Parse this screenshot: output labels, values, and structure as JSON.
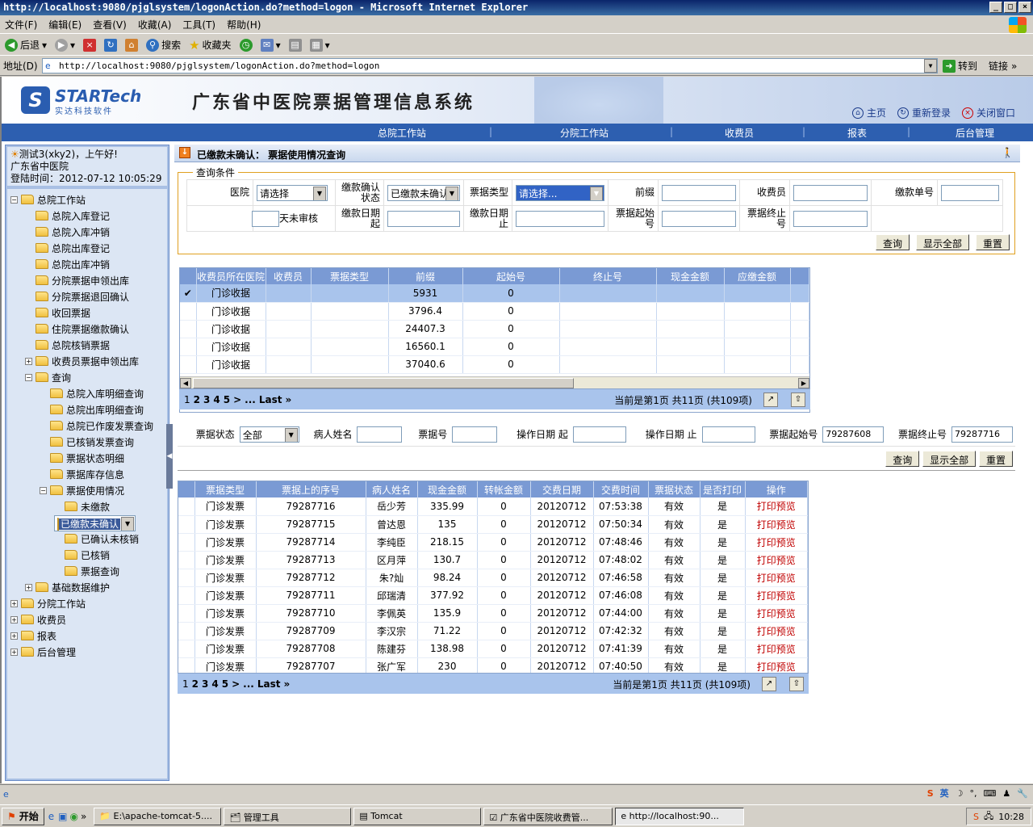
{
  "window": {
    "title": "http://localhost:9080/pjglsystem/logonAction.do?method=logon - Microsoft Internet Explorer"
  },
  "menu": [
    "文件(F)",
    "编辑(E)",
    "查看(V)",
    "收藏(A)",
    "工具(T)",
    "帮助(H)"
  ],
  "toolbar": {
    "back": "后退",
    "search": "搜索",
    "favorites": "收藏夹"
  },
  "address": {
    "label": "地址(D)",
    "url": "http://localhost:9080/pjglsystem/logonAction.do?method=logon",
    "go": "转到",
    "links": "链接"
  },
  "header": {
    "logo_main": "STARTech",
    "logo_sub": "实达科技软件",
    "title": "广东省中医院票据管理信息系统",
    "links": [
      "主页",
      "重新登录",
      "关闭窗口"
    ]
  },
  "nav": [
    "总院工作站",
    "分院工作站",
    "收费员",
    "报表",
    "后台管理"
  ],
  "user": {
    "greeting": "测试3(xky2)，上午好!",
    "org": "广东省中医院",
    "login_time": "登陆时间：2012-07-12 10:05:29"
  },
  "tree": [
    {
      "label": "总院工作站",
      "depth": 0,
      "pm": "−"
    },
    {
      "label": "总院入库登记",
      "depth": 1
    },
    {
      "label": "总院入库冲销",
      "depth": 1
    },
    {
      "label": "总院出库登记",
      "depth": 1
    },
    {
      "label": "总院出库冲销",
      "depth": 1
    },
    {
      "label": "分院票据申领出库",
      "depth": 1
    },
    {
      "label": "分院票据退回确认",
      "depth": 1
    },
    {
      "label": "收回票据",
      "depth": 1
    },
    {
      "label": "住院票据缴款确认",
      "depth": 1
    },
    {
      "label": "总院核销票据",
      "depth": 1
    },
    {
      "label": "收费员票据申领出库",
      "depth": 1,
      "pm": "+"
    },
    {
      "label": "查询",
      "depth": 1,
      "pm": "−"
    },
    {
      "label": "总院入库明细查询",
      "depth": 2
    },
    {
      "label": "总院出库明细查询",
      "depth": 2
    },
    {
      "label": "总院已作废发票查询",
      "depth": 2
    },
    {
      "label": "已核销发票查询",
      "depth": 2
    },
    {
      "label": "票据状态明细",
      "depth": 2
    },
    {
      "label": "票据库存信息",
      "depth": 2
    },
    {
      "label": "票据使用情况",
      "depth": 2,
      "pm": "−"
    },
    {
      "label": "未缴款",
      "depth": 3
    },
    {
      "label": "已缴款未确认",
      "depth": 3,
      "selected": true
    },
    {
      "label": "已确认未核销",
      "depth": 3
    },
    {
      "label": "已核销",
      "depth": 3
    },
    {
      "label": "票据查询",
      "depth": 3
    },
    {
      "label": "基础数据维护",
      "depth": 1,
      "pm": "+"
    },
    {
      "label": "分院工作站",
      "depth": 0,
      "pm": "+"
    },
    {
      "label": "收费员",
      "depth": 0,
      "pm": "+"
    },
    {
      "label": "报表",
      "depth": 0,
      "pm": "+"
    },
    {
      "label": "后台管理",
      "depth": 0,
      "pm": "+"
    }
  ],
  "crumb": "已缴款未确认：  票据使用情况查询",
  "query": {
    "legend": "查询条件",
    "hospital_label": "医院",
    "hospital_value": "请选择",
    "pay_status_label": "缴款确认状态",
    "pay_status_value": "已缴款未确认",
    "bill_type_label": "票据类型",
    "bill_type_value": "请选择...",
    "prefix_label": "前缀",
    "cashier_label": "收费员",
    "pay_no_label": "缴款单号",
    "days_label": "天未审核",
    "pay_date_from_label": "缴款日期起",
    "pay_date_to_label": "缴款日期止",
    "bill_start_label": "票据起始号",
    "bill_end_label": "票据终止号",
    "btn_query": "查询",
    "btn_all": "显示全部",
    "btn_reset": "重置"
  },
  "grid1": {
    "columns": [
      "收费员所在医院",
      "收费员",
      "票据类型",
      "前缀",
      "起始号",
      "终止号",
      "现金金额",
      "应缴金额"
    ],
    "rows": [
      [
        "门诊收据",
        "",
        "",
        "5931",
        "0",
        "",
        "",
        ""
      ],
      [
        "门诊收据",
        "",
        "",
        "3796.4",
        "0",
        "",
        "",
        ""
      ],
      [
        "门诊收据",
        "",
        "",
        "24407.3",
        "0",
        "",
        "",
        ""
      ],
      [
        "门诊收据",
        "",
        "",
        "16560.1",
        "0",
        "",
        "",
        ""
      ],
      [
        "门诊收据",
        "",
        "",
        "37040.6",
        "0",
        "",
        "",
        ""
      ]
    ],
    "pages": [
      "1",
      "2",
      "3",
      "4",
      "5",
      ">",
      "...",
      "Last",
      "»"
    ],
    "info": "当前是第1页 共11页 (共109项)"
  },
  "filter2": {
    "status_label": "票据状态",
    "status_value": "全部",
    "patient_label": "病人姓名",
    "bill_no_label": "票据号",
    "op_from_label": "操作日期 起",
    "op_to_label": "操作日期 止",
    "start_label": "票据起始号",
    "start_value": "79287608",
    "end_label": "票据终止号",
    "end_value": "79287716",
    "btn_query": "查询",
    "btn_all": "显示全部",
    "btn_reset": "重置"
  },
  "grid2": {
    "columns": [
      "票据类型",
      "票据上的序号",
      "病人姓名",
      "现金金额",
      "转帐金额",
      "交费日期",
      "交费时间",
      "票据状态",
      "是否打印",
      "操作"
    ],
    "rows": [
      [
        "门诊发票",
        "79287716",
        "岳少芳",
        "335.99",
        "0",
        "20120712",
        "07:53:38",
        "有效",
        "是",
        "打印预览"
      ],
      [
        "门诊发票",
        "79287715",
        "曾达恩",
        "135",
        "0",
        "20120712",
        "07:50:34",
        "有效",
        "是",
        "打印预览"
      ],
      [
        "门诊发票",
        "79287714",
        "李纯臣",
        "218.15",
        "0",
        "20120712",
        "07:48:46",
        "有效",
        "是",
        "打印预览"
      ],
      [
        "门诊发票",
        "79287713",
        "区月萍",
        "130.7",
        "0",
        "20120712",
        "07:48:02",
        "有效",
        "是",
        "打印预览"
      ],
      [
        "门诊发票",
        "79287712",
        "朱?灿",
        "98.24",
        "0",
        "20120712",
        "07:46:58",
        "有效",
        "是",
        "打印预览"
      ],
      [
        "门诊发票",
        "79287711",
        "邱瑞清",
        "377.92",
        "0",
        "20120712",
        "07:46:08",
        "有效",
        "是",
        "打印预览"
      ],
      [
        "门诊发票",
        "79287710",
        "李佩英",
        "135.9",
        "0",
        "20120712",
        "07:44:00",
        "有效",
        "是",
        "打印预览"
      ],
      [
        "门诊发票",
        "79287709",
        "李汉宗",
        "71.22",
        "0",
        "20120712",
        "07:42:32",
        "有效",
        "是",
        "打印预览"
      ],
      [
        "门诊发票",
        "79287708",
        "陈建芬",
        "138.98",
        "0",
        "20120712",
        "07:41:39",
        "有效",
        "是",
        "打印预览"
      ],
      [
        "门诊发票",
        "79287707",
        "张广军",
        "230",
        "0",
        "20120712",
        "07:40:50",
        "有效",
        "是",
        "打印预览"
      ]
    ],
    "pages": [
      "1",
      "2",
      "3",
      "4",
      "5",
      ">",
      "...",
      "Last",
      "»"
    ],
    "info": "当前是第1页 共11页 (共109项)"
  },
  "taskbar": {
    "start": "开始",
    "tasks": [
      "E:\\apache-tomcat-5....",
      "管理工具",
      "Tomcat",
      "广东省中医院收费管...",
      "http://localhost:90..."
    ],
    "time": "10:28",
    "ime": "英"
  }
}
